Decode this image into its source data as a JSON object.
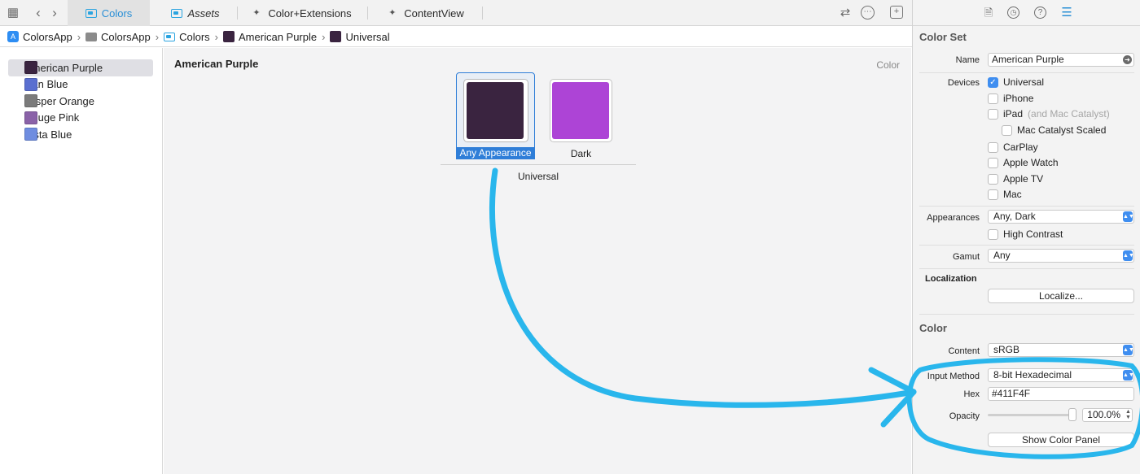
{
  "tabbar": {
    "tabs": [
      {
        "label": "Colors",
        "icon": "asset-catalog-icon",
        "active": true
      },
      {
        "label": "Assets",
        "icon": "asset-catalog-icon",
        "italic": true
      },
      {
        "label": "Color+Extensions",
        "icon": "swift-file-icon"
      },
      {
        "label": "ContentView",
        "icon": "swift-file-icon"
      }
    ],
    "left_icons": [
      "grid-icon",
      "chevron-left-icon",
      "chevron-right-icon"
    ],
    "right_icons": [
      "swap-icon",
      "ellipsis-icon",
      "add-editor-icon"
    ]
  },
  "breadcrumb": {
    "items": [
      "ColorsApp",
      "ColorsApp",
      "Colors",
      "American Purple",
      "Universal"
    ]
  },
  "sidebar": {
    "items": [
      {
        "label": "American Purple",
        "color": "#3a2440",
        "selected": true
      },
      {
        "label": "Han Blue",
        "color": "#5a6fd0"
      },
      {
        "label": "Jasper Orange",
        "color": "#7b7b7b"
      },
      {
        "label": "Rouge Pink",
        "color": "#8a62a8"
      },
      {
        "label": "Vista Blue",
        "color": "#6f8de0"
      }
    ]
  },
  "canvas": {
    "title": "American Purple",
    "kind": "Color",
    "wells": [
      {
        "label": "Any Appearance",
        "color": "#3a2440",
        "selected": true
      },
      {
        "label": "Dark",
        "color": "#ad44d6"
      }
    ],
    "group_label": "Universal"
  },
  "annotation": {
    "color": "#29b6ec"
  },
  "inspector": {
    "tabs": [
      "file-icon",
      "history-icon",
      "help-icon",
      "attributes-icon"
    ],
    "color_set_title": "Color Set",
    "name_label": "Name",
    "name_value": "American Purple",
    "devices_label": "Devices",
    "devices": [
      {
        "label": "Universal",
        "checked": true
      },
      {
        "label": "iPhone",
        "checked": false
      },
      {
        "label": "iPad",
        "hint": "(and Mac Catalyst)",
        "checked": false
      },
      {
        "label": "Mac Catalyst Scaled",
        "checked": false,
        "indent": true
      },
      {
        "label": "CarPlay",
        "checked": false
      },
      {
        "label": "Apple Watch",
        "checked": false
      },
      {
        "label": "Apple TV",
        "checked": false
      },
      {
        "label": "Mac",
        "checked": false
      }
    ],
    "appearances_label": "Appearances",
    "appearances_value": "Any, Dark",
    "high_contrast_label": "High Contrast",
    "gamut_label": "Gamut",
    "gamut_value": "Any",
    "localization_title": "Localization",
    "localize_button": "Localize...",
    "color_title": "Color",
    "content_label": "Content",
    "content_value": "sRGB",
    "input_method_label": "Input Method",
    "input_method_value": "8-bit Hexadecimal",
    "hex_label": "Hex",
    "hex_value": "#411F4F",
    "opacity_label": "Opacity",
    "opacity_value": "100.0%",
    "show_color_panel_button": "Show Color Panel"
  }
}
